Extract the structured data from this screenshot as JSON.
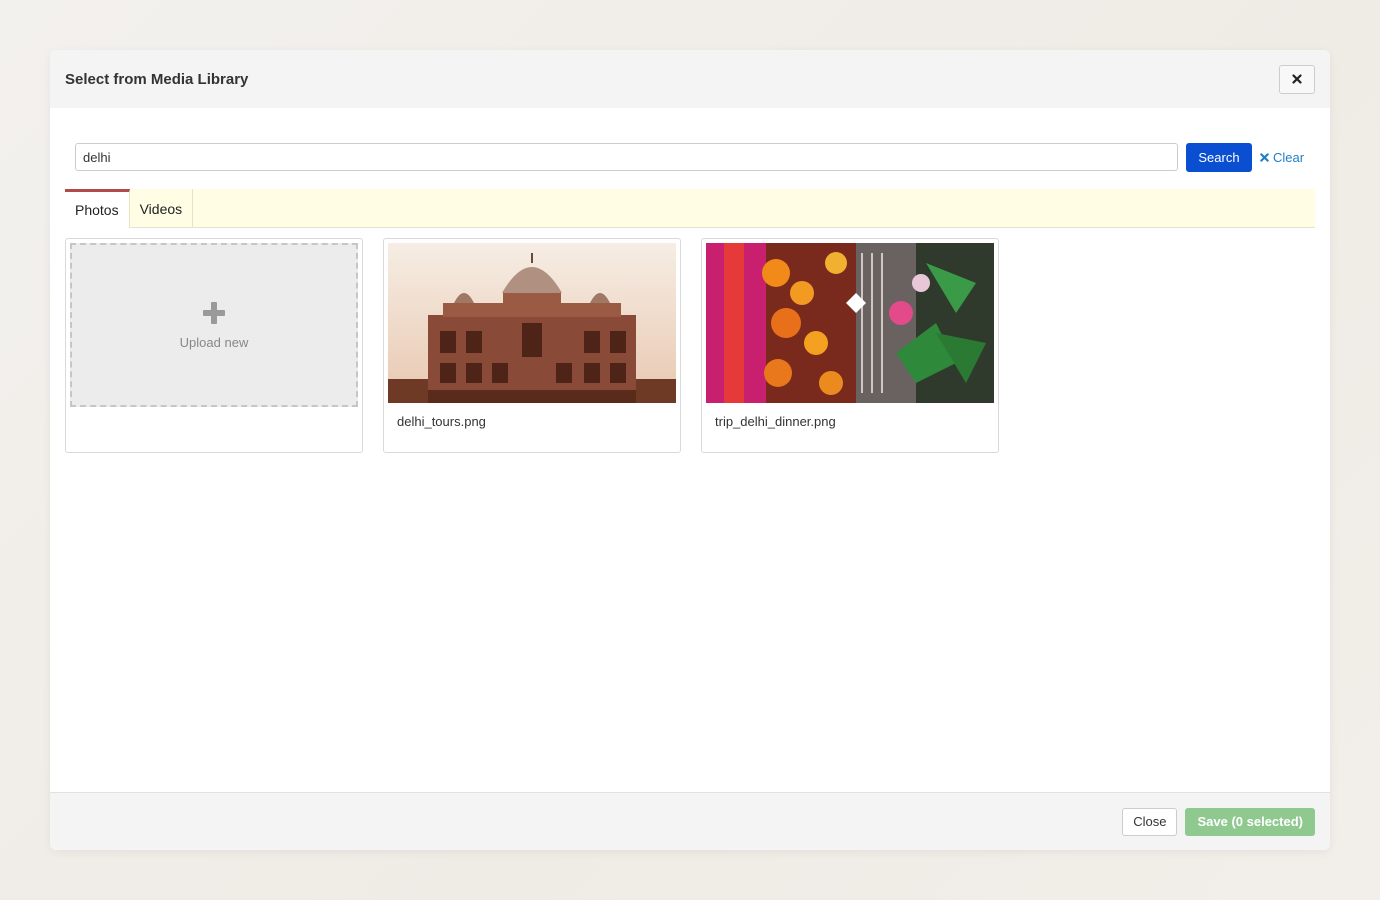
{
  "modal": {
    "title": "Select from Media Library",
    "close_icon": "close-icon"
  },
  "search": {
    "value": "delhi",
    "button_label": "Search",
    "clear_label": "Clear",
    "clear_icon": "close-icon"
  },
  "tabs": [
    {
      "label": "Photos",
      "active": true
    },
    {
      "label": "Videos",
      "active": false
    }
  ],
  "media": {
    "upload_label": "Upload new",
    "upload_icon": "plus-icon",
    "items": [
      {
        "name": "delhi_tours.png"
      },
      {
        "name": "trip_delhi_dinner.png"
      }
    ]
  },
  "footer": {
    "close_label": "Close",
    "save_label": "Save (0 selected)"
  },
  "colors": {
    "primary": "#0a4fd1",
    "link": "#1e7fc8",
    "active_tab_accent": "#b14a4a",
    "tab_bar_bg": "#fffde3",
    "save_disabled": "#8fc98f"
  }
}
